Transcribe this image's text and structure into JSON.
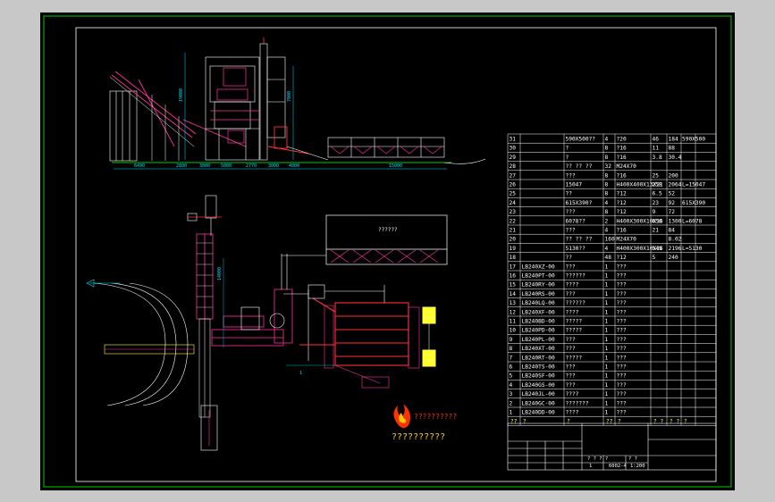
{
  "bom": {
    "rows": [
      {
        "no": "31",
        "code": "",
        "name": "590X500??",
        "qty": "4",
        "mat": "?20",
        "w1": "46",
        "w2": "184",
        "note": "590X500"
      },
      {
        "no": "30",
        "code": "",
        "name": "?",
        "qty": "8",
        "mat": "?16",
        "w1": "11",
        "w2": "88",
        "note": ""
      },
      {
        "no": "29",
        "code": "",
        "name": "?",
        "qty": "8",
        "mat": "?16",
        "w1": "3.8",
        "w2": "30.4",
        "note": ""
      },
      {
        "no": "28",
        "code": "",
        "name": "?? ?? ??",
        "qty": "32",
        "mat": "M24X70",
        "w1": "",
        "w2": "",
        "note": ""
      },
      {
        "no": "27",
        "code": "",
        "name": "???",
        "qty": "8",
        "mat": "?16",
        "w1": "25",
        "w2": "200",
        "note": ""
      },
      {
        "no": "26",
        "code": "",
        "name": "15047",
        "qty": "8",
        "mat": "H400X400X13X21",
        "w1": "258",
        "w2": "2064",
        "note": "L=15047"
      },
      {
        "no": "25",
        "code": "",
        "name": "??",
        "qty": "8",
        "mat": "?12",
        "w1": "6.5",
        "w2": "52",
        "note": ""
      },
      {
        "no": "24",
        "code": "",
        "name": "615X390?",
        "qty": "4",
        "mat": "?12",
        "w1": "23",
        "w2": "92",
        "note": "615X390"
      },
      {
        "no": "23",
        "code": "",
        "name": "???",
        "qty": "8",
        "mat": "?12",
        "w1": "9",
        "w2": "72",
        "note": ""
      },
      {
        "no": "22",
        "code": "",
        "name": "6078??",
        "qty": "2",
        "mat": "H400X300X10X16",
        "w1": "650",
        "w2": "1300",
        "note": "L=6078"
      },
      {
        "no": "21",
        "code": "",
        "name": "???",
        "qty": "4",
        "mat": "?16",
        "w1": "21",
        "w2": "84",
        "note": ""
      },
      {
        "no": "20",
        "code": "",
        "name": "?? ?? ??",
        "qty": "160",
        "mat": "M24X70",
        "w1": "",
        "w2": "8.02",
        "note": ""
      },
      {
        "no": "19",
        "code": "",
        "name": "5130??",
        "qty": "4",
        "mat": "H400X300X10X16",
        "w1": "549",
        "w2": "2196",
        "note": "L=5130"
      },
      {
        "no": "18",
        "code": "",
        "name": "??",
        "qty": "48",
        "mat": "?12",
        "w1": "5",
        "w2": "240",
        "note": ""
      },
      {
        "no": "17",
        "code": "LB240XZ-00",
        "name": "???",
        "qty": "1",
        "mat": "???",
        "w1": "",
        "w2": "",
        "note": ""
      },
      {
        "no": "16",
        "code": "LB240PT-00",
        "name": "??????",
        "qty": "1",
        "mat": "???",
        "w1": "",
        "w2": "",
        "note": ""
      },
      {
        "no": "15",
        "code": "LB240RY-00",
        "name": "????",
        "qty": "1",
        "mat": "???",
        "w1": "",
        "w2": "",
        "note": ""
      },
      {
        "no": "14",
        "code": "LB240RS-00",
        "name": "???",
        "qty": "1",
        "mat": "???",
        "w1": "",
        "w2": "",
        "note": ""
      },
      {
        "no": "13",
        "code": "LB240LQ-00",
        "name": "??????",
        "qty": "1",
        "mat": "???",
        "w1": "",
        "w2": "",
        "note": ""
      },
      {
        "no": "12",
        "code": "LB240XF-00",
        "name": "????",
        "qty": "1",
        "mat": "???",
        "w1": "",
        "w2": "",
        "note": ""
      },
      {
        "no": "11",
        "code": "LB240BD-00",
        "name": "?????",
        "qty": "1",
        "mat": "???",
        "w1": "",
        "w2": "",
        "note": ""
      },
      {
        "no": "10",
        "code": "LB240PD-00",
        "name": "?????",
        "qty": "1",
        "mat": "???",
        "w1": "",
        "w2": "",
        "note": ""
      },
      {
        "no": "9",
        "code": "LB240PL-00",
        "name": "???",
        "qty": "1",
        "mat": "???",
        "w1": "",
        "w2": "",
        "note": ""
      },
      {
        "no": "8",
        "code": "LB240XT-00",
        "name": "???",
        "qty": "1",
        "mat": "???",
        "w1": "",
        "w2": "",
        "note": ""
      },
      {
        "no": "7",
        "code": "LB240RT-00",
        "name": "?????",
        "qty": "1",
        "mat": "???",
        "w1": "",
        "w2": "",
        "note": ""
      },
      {
        "no": "6",
        "code": "LB240TS-00",
        "name": "???",
        "qty": "1",
        "mat": "???",
        "w1": "",
        "w2": "",
        "note": ""
      },
      {
        "no": "5",
        "code": "LB240SF-00",
        "name": "???",
        "qty": "1",
        "mat": "???",
        "w1": "",
        "w2": "",
        "note": ""
      },
      {
        "no": "4",
        "code": "LB240GS-00",
        "name": "???",
        "qty": "1",
        "mat": "???",
        "w1": "",
        "w2": "",
        "note": ""
      },
      {
        "no": "3",
        "code": "LB240JL-00",
        "name": "????",
        "qty": "1",
        "mat": "???",
        "w1": "",
        "w2": "",
        "note": ""
      },
      {
        "no": "2",
        "code": "LB240GC-00",
        "name": "???????",
        "qty": "1",
        "mat": "???",
        "w1": "",
        "w2": "",
        "note": ""
      },
      {
        "no": "1",
        "code": "LB240DD-00",
        "name": "????",
        "qty": "1",
        "mat": "???",
        "w1": "",
        "w2": "",
        "note": ""
      }
    ],
    "header": {
      "no": "??",
      "code": "?",
      "name": "?",
      "qty": "??",
      "mat": "?",
      "w1": "? ?",
      "w2": "? ?",
      "note": "?"
    }
  },
  "title_block": {
    "mid1": "? ? ? ?",
    "mid2": "? ?",
    "scale_label": "6002-4",
    "scale": "1:200",
    "one": "1"
  },
  "stamp": {
    "line1": "??????????",
    "line2": "??????????"
  },
  "plan_label": "??????",
  "dimensions_top": [
    "6490",
    "2800",
    "3000",
    "5000",
    "2770",
    "3000",
    "4000",
    "15000"
  ],
  "dimensions_vert": [
    "19000",
    "7000"
  ],
  "plan_dims": [
    "14000",
    "1"
  ],
  "colors": {
    "canvas": "#000000",
    "frame": "#00cc00",
    "line": "#ffffff",
    "cyan": "#00e0ff",
    "magenta": "#ff3399",
    "red": "#ff3030",
    "yellow": "#ffff33"
  }
}
